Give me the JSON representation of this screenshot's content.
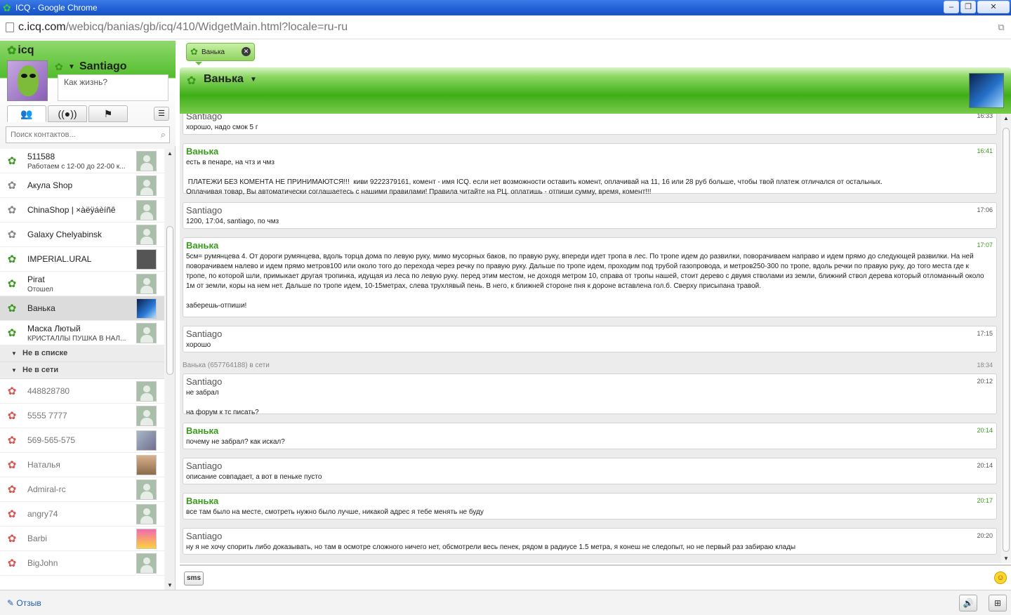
{
  "window": {
    "title": "ICQ - Google Chrome",
    "url_host": "c.icq.com",
    "url_path": "/webicq/banias/gb/icq/410/WidgetMain.html?locale=ru-ru"
  },
  "sidebar": {
    "logo": "icq",
    "me_name": "Santiago",
    "status_placeholder": "Как жизнь?",
    "search_placeholder": "Поиск контактов...",
    "tabs": [
      "contacts-icon",
      "broadcast-icon",
      "flag-icon"
    ],
    "online": [
      {
        "name": "511588",
        "sub": "Работаем с 12-00 до 22-00 к...",
        "status": "online"
      },
      {
        "name": "Акула Shop",
        "sub": "",
        "status": "grey"
      },
      {
        "name": "ChinaShop | ×àëÿáèíñê",
        "sub": "",
        "status": "grey"
      },
      {
        "name": "Galaxy Chelyabinsk",
        "sub": "",
        "status": "grey"
      },
      {
        "name": "IMPERIAL.URAL",
        "sub": "",
        "status": "online"
      },
      {
        "name": "Pirat",
        "sub": "Отошел",
        "status": "online"
      },
      {
        "name": "Ванька",
        "sub": "",
        "status": "online"
      },
      {
        "name": "Маска Лютый",
        "sub": "КРИСТАЛЛЫ ПУШКА В НАЛ...",
        "status": "online"
      }
    ],
    "groups": {
      "not_in_list": "Не в списке",
      "offline": "Не в сети"
    },
    "offline": [
      {
        "name": "448828780"
      },
      {
        "name": "5555 7777"
      },
      {
        "name": "569-565-575"
      },
      {
        "name": "Наталья"
      },
      {
        "name": "Admiral-rc"
      },
      {
        "name": "angry74"
      },
      {
        "name": "Barbi"
      },
      {
        "name": "BigJohn"
      }
    ]
  },
  "chat": {
    "tab_label": "Ванька",
    "header_name": "Ванька",
    "messages": [
      {
        "from": "Santiago",
        "time": "16:33",
        "text": "хорошо, надо смок 5 г",
        "me": true
      },
      {
        "from": "Ванька",
        "time": "16:41",
        "text": "есть в пенаре, на чтз и чмз\n\n ПЛАТЕЖИ БЕЗ КОМЕНТА НЕ ПРИНИМАЮТСЯ!!!  киви 9222379161, комент - имя ICQ. если нет возможности оставить комент, оплачивай на 11, 16 или 28 руб больше, чтобы твой платеж отличался от остальных.\nОплачивая товар, Вы автоматически соглашаетесь с нашими правилами! Правила читайте на РЦ. оплатишь - отпиши сумму, время, комент!!!",
        "me": false
      },
      {
        "from": "Santiago",
        "time": "17:06",
        "text": "1200, 17:04, santiago, по чмз",
        "me": true
      },
      {
        "from": "Ванька",
        "time": "17:07",
        "text": "5см= румянцева 4. От дороги румянцева, вдоль торца дома по левую руку, мимо мусорных баков, по правую руку, впереди идет тропа в лес. По тропе идем до развилки, поворачиваем направо и идем прямо до следующей развилки. На ней поворачиваем налево и идем прямо метров100 или около того до перехода через речку по правую руку. Дальше по тропе идем, проходим под трубой газопровода, и метров250-300 по тропе, вдоль речки по правую руку, до того места где к тропе, по которой шли, примыкает другая тропинка, идущая из леса по левую руку. перед этим местом, не доходя метром 10, справа от тропы нашей, стоит дерево с двумя стволами из земли, ближний ствол дерева который отломанный около 1м от земли, коры на нем нет. Дальше по тропе идем, 10-15метрах, слева трухлявый пень. В него, к ближней стороне пня к дороне вставлена гол.б. Сверху присыпана травой.\n\nзаберешь-отпиши!",
        "me": false
      },
      {
        "from": "Santiago",
        "time": "17:15",
        "text": "хорошо",
        "me": true
      },
      {
        "from": "Santiago",
        "time": "20:12",
        "text": "не забрал\n\nна форум к тс писать?",
        "me": true
      },
      {
        "from": "Ванька",
        "time": "20:14",
        "text": "почему не забрал? как искал?",
        "me": false
      },
      {
        "from": "Santiago",
        "time": "20:14",
        "text": "описание совпадает, а вот в пеньке пусто",
        "me": true
      },
      {
        "from": "Ванька",
        "time": "20:17",
        "text": "все там было на месте, смотреть нужно было лучше, никакой адрес я тебе менять не буду",
        "me": false
      },
      {
        "from": "Santiago",
        "time": "20:20",
        "text": "ну я не хочу спорить либо доказывать, но там в осмотре сложного ничего нет, обсмотрели весь пенек, рядом в радиусе 1.5 метра, я конеш не следопыт, но не первый раз забираю клады",
        "me": true
      }
    ],
    "system_line": {
      "text": "Ванька (657764188) в сети",
      "time": "18:34"
    },
    "sms_label": "sms"
  },
  "footer": {
    "feedback": "Отзыв"
  }
}
